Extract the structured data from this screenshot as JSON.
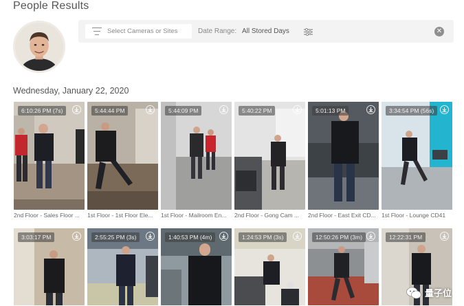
{
  "page": {
    "title": "People Results",
    "date_heading": "Wednesday, January 22, 2020"
  },
  "filters": {
    "camera_placeholder": "Select Cameras or Sites",
    "date_range_label": "Date Range:",
    "date_range_value": "All Stored Days"
  },
  "results": [
    {
      "time": "6:10:26 PM (7s)",
      "camera": "2nd Floor - Sales Floor ..."
    },
    {
      "time": "5:44:44 PM",
      "camera": "1st Floor - 1st Floor Ele..."
    },
    {
      "time": "5:44:09 PM",
      "camera": "1st Floor - Mailroom En..."
    },
    {
      "time": "5:40:22 PM",
      "camera": "2nd Floor - Gong Cam ..."
    },
    {
      "time": "5:01:13 PM",
      "camera": "2nd Floor - East Exit CD..."
    },
    {
      "time": "3:34:54 PM (56s)",
      "camera": "1st Floor - Lounge CD41"
    },
    {
      "time": "3:03:17 PM",
      "camera": ""
    },
    {
      "time": "2:55:25 PM (3s)",
      "camera": ""
    },
    {
      "time": "1:40:53 PM (4m)",
      "camera": ""
    },
    {
      "time": "1:24:53 PM (3s)",
      "camera": ""
    },
    {
      "time": "12:50:26 PM (3m)",
      "camera": ""
    },
    {
      "time": "12:22:31 PM",
      "camera": ""
    }
  ],
  "watermark": {
    "text": "量子位"
  },
  "colors": {
    "filter_bar": "#f3f3f3",
    "timestamp_bg": "#3c3c3c",
    "text": "#555555"
  }
}
